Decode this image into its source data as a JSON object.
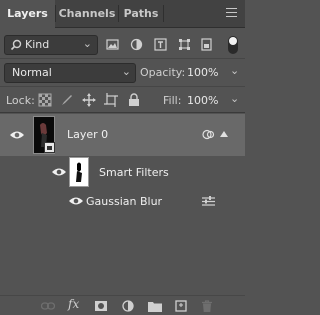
{
  "tabs": [
    {
      "label": "Layers",
      "active": true
    },
    {
      "label": "Channels",
      "active": false
    },
    {
      "label": "Paths",
      "active": false
    }
  ],
  "filter": {
    "kind_label": "Kind"
  },
  "blend": {
    "mode": "Normal",
    "opacity_label": "Opacity:",
    "opacity_value": "100%"
  },
  "lock": {
    "label": "Lock:",
    "fill_label": "Fill:",
    "fill_value": "100%"
  },
  "layers": {
    "layer0": {
      "name": "Layer 0"
    },
    "smart_filters": {
      "name": "Smart Filters"
    },
    "filter_effect": {
      "name": "Gaussian Blur"
    }
  },
  "bottom_bar": {
    "fx_label": "fx"
  },
  "colors": {
    "panel_bg": "#535353",
    "tab_bg": "#424242",
    "selected_row": "#696969",
    "field_bg": "#3c3c3c"
  }
}
